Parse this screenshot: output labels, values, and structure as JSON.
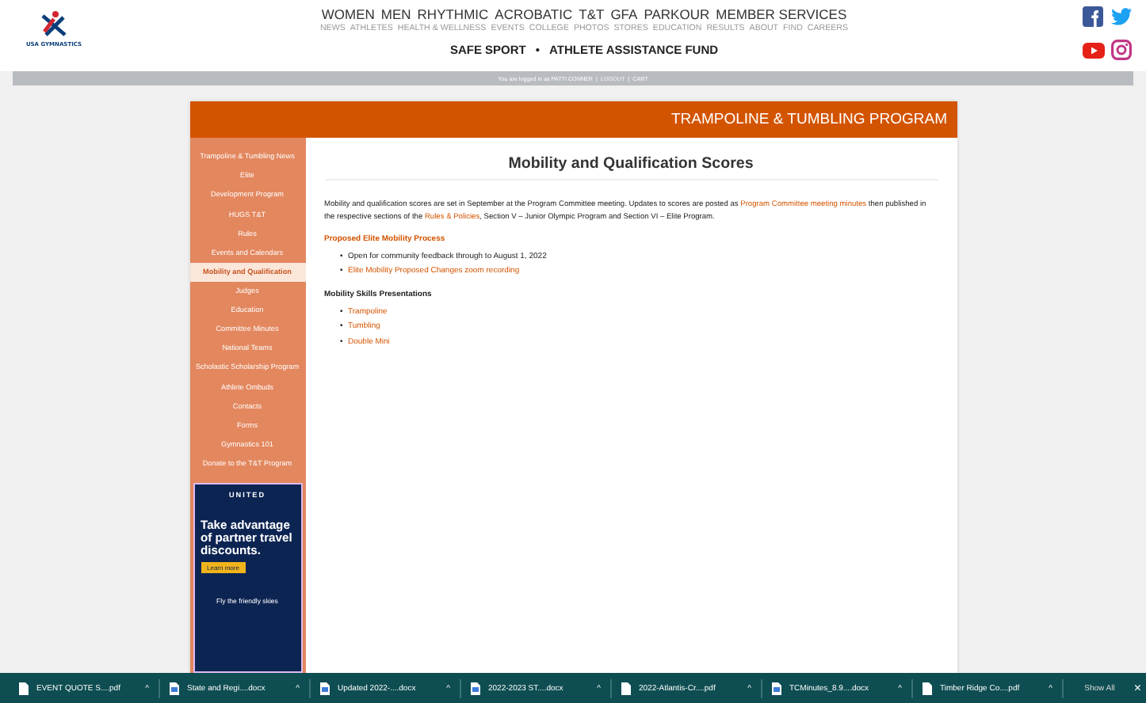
{
  "header": {
    "logo_text": "USA GYMNASTICS",
    "main_nav": [
      "WOMEN",
      "MEN",
      "RHYTHMIC",
      "ACROBATIC",
      "T&T",
      "GFA",
      "PARKOUR",
      "MEMBER SERVICES"
    ],
    "sub_nav": [
      "NEWS",
      "ATHLETES",
      "HEALTH & WELLNESS",
      "EVENTS",
      "COLLEGE",
      "PHOTOS",
      "STORES",
      "EDUCATION",
      "RESULTS",
      "ABOUT",
      "FIND",
      "CAREERS"
    ],
    "feature_links": [
      "SAFE SPORT",
      "ATHLETE ASSISTANCE FUND"
    ],
    "separator": "•"
  },
  "login_bar": {
    "text": "You are logged in as PATTI CONNER",
    "logout": "LOGOUT",
    "cart": "CART",
    "separator": "|"
  },
  "program_title": "TRAMPOLINE & TUMBLING PROGRAM",
  "sidebar": {
    "items": [
      {
        "label": "Trampoline & Tumbling News",
        "selected": false
      },
      {
        "label": "Elite",
        "selected": false
      },
      {
        "label": "Development Program",
        "selected": false
      },
      {
        "label": "HUGS T&T",
        "selected": false
      },
      {
        "label": "Rules",
        "selected": false
      },
      {
        "label": "Events and Calendars",
        "selected": false
      },
      {
        "label": "Mobility and Qualification",
        "selected": true
      },
      {
        "label": "Judges",
        "selected": false
      },
      {
        "label": "Education",
        "selected": false
      },
      {
        "label": "Committee Minutes",
        "selected": false
      },
      {
        "label": "National Teams",
        "selected": false
      },
      {
        "label": "Scholastic Scholarship Program",
        "selected": false
      },
      {
        "label": "Athlete Ombuds",
        "selected": false
      },
      {
        "label": "Contacts",
        "selected": false
      },
      {
        "label": "Forms",
        "selected": false
      },
      {
        "label": "Gymnastics 101",
        "selected": false
      },
      {
        "label": "Donate to the T&T Program",
        "selected": false
      }
    ],
    "ad": {
      "brand": "UNITED",
      "headline": "Take advantage of partner travel discounts.",
      "button": "Learn more",
      "tagline": "Fly the friendly skies"
    }
  },
  "content": {
    "title": "Mobility and Qualification Scores",
    "intro": [
      {
        "kind": "text",
        "text": "Mobility and qualification scores are set in September at the Program Committee meeting. Updates to scores are posted as "
      },
      {
        "kind": "link",
        "text": "Program Committee meeting minutes"
      },
      {
        "kind": "text",
        "text": " then published in the respective sections of the "
      },
      {
        "kind": "link",
        "text": "Rules & Policies"
      },
      {
        "kind": "text",
        "text": ", Section V – Junior Olympic Program and Section VI – Elite Program."
      }
    ],
    "bullet": "•",
    "sections": [
      {
        "heading": "Proposed Elite Mobility Process",
        "kind": "accent",
        "items": [
          {
            "text": "Open for community feedback through to August 1, 2022",
            "kind": "text"
          },
          {
            "text": "Elite Mobility Proposed Changes zoom recording",
            "kind": "link"
          }
        ]
      },
      {
        "heading": "Mobility Skills Presentations",
        "kind": "plain",
        "items": [
          {
            "text": "Trampoline",
            "kind": "link"
          },
          {
            "text": "Tumbling",
            "kind": "link"
          },
          {
            "text": "Double Mini",
            "kind": "link"
          }
        ]
      }
    ]
  },
  "downloads": {
    "items": [
      {
        "name": "EVENT QUOTE S....pdf",
        "kind": "pdf"
      },
      {
        "name": "State and Regi....docx",
        "kind": "doc"
      },
      {
        "name": "Updated 2022-....docx",
        "kind": "doc"
      },
      {
        "name": "2022-2023 ST....docx",
        "kind": "doc"
      },
      {
        "name": "2022-Atlantis-Cr....pdf",
        "kind": "pdf"
      },
      {
        "name": "TCMinutes_8.9....docx",
        "kind": "doc"
      },
      {
        "name": "Timber Ridge Co....pdf",
        "kind": "pdf"
      }
    ],
    "caret": "^",
    "show_all": "Show All",
    "close": "×"
  }
}
